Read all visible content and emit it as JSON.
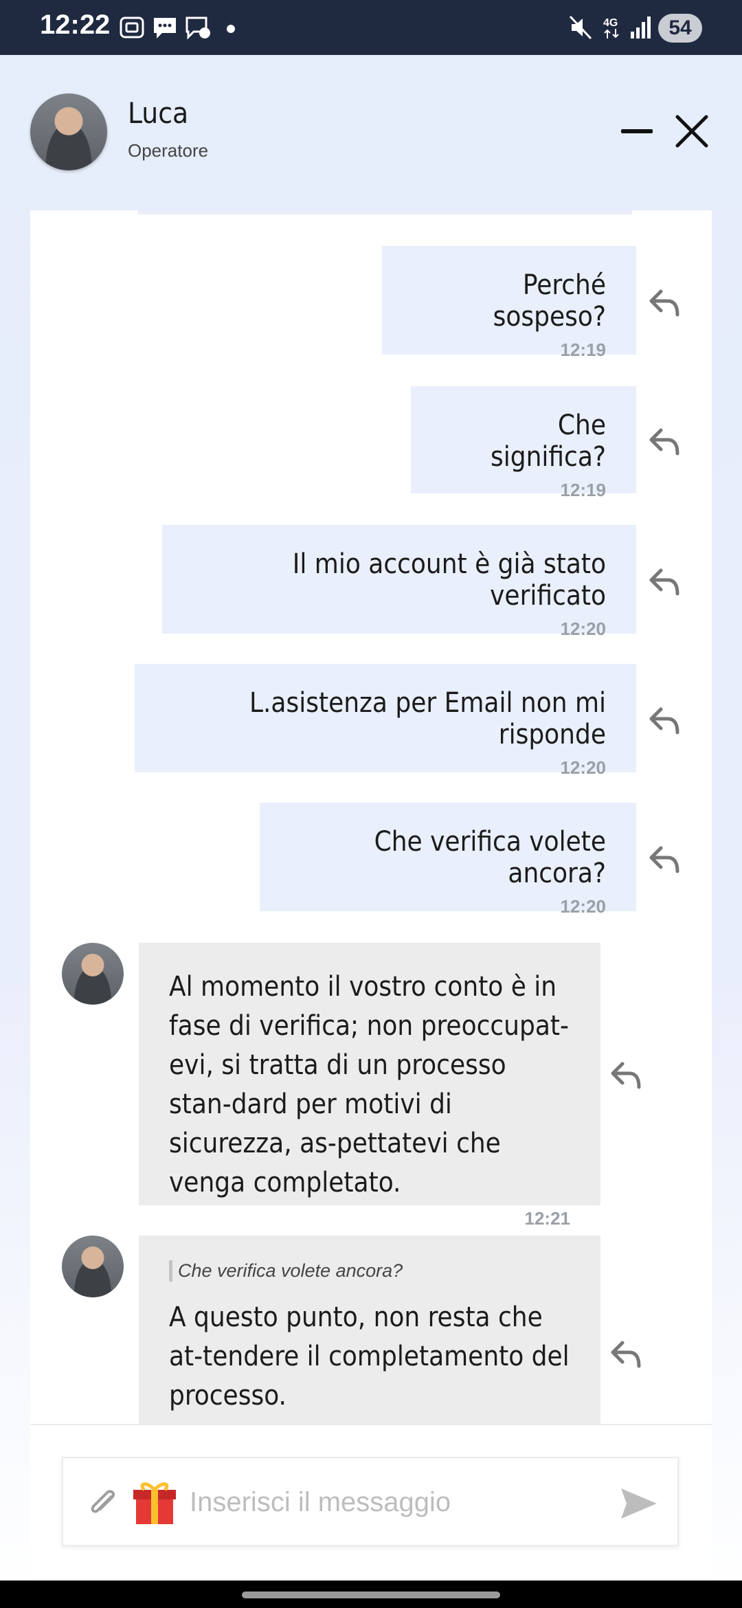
{
  "status_bar": {
    "time": "12:22",
    "battery": "54"
  },
  "header": {
    "agent_name": "Luca",
    "agent_role": "Operatore"
  },
  "messages_out": [
    {
      "text": "Perché sospeso?",
      "time": "12:19"
    },
    {
      "text": "Che significa?",
      "time": "12:19"
    },
    {
      "text": "Il mio account è già stato verificato",
      "time": "12:20"
    },
    {
      "text": "L.asistenza per Email non mi risponde",
      "time": "12:20"
    },
    {
      "text": "Che verifica volete ancora?",
      "time": "12:20"
    }
  ],
  "messages_in": [
    {
      "text": "Al momento il vostro conto è in fase di verifica; non preoccupat-evi, si tratta di un processo stan-dard per motivi di sicurezza, as-pettatevi che venga completato.",
      "time": "12:21"
    },
    {
      "quote": "Che verifica volete ancora?",
      "text": "A questo punto, non resta che at-tendere il completamento del processo."
    }
  ],
  "composer": {
    "placeholder": "Inserisci il messaggio"
  },
  "colors": {
    "status_bar": "#1f2940",
    "bubble_out": "#e9effb",
    "bubble_in": "#ececec",
    "accent_icon": "#777777"
  },
  "icons": [
    "screenshot-icon",
    "messages-icon",
    "messenger-icon",
    "mute-icon",
    "network-4g-icon",
    "signal-icon",
    "minimize-icon",
    "close-icon",
    "reply-icon",
    "attach-icon",
    "gift-icon",
    "send-icon"
  ]
}
